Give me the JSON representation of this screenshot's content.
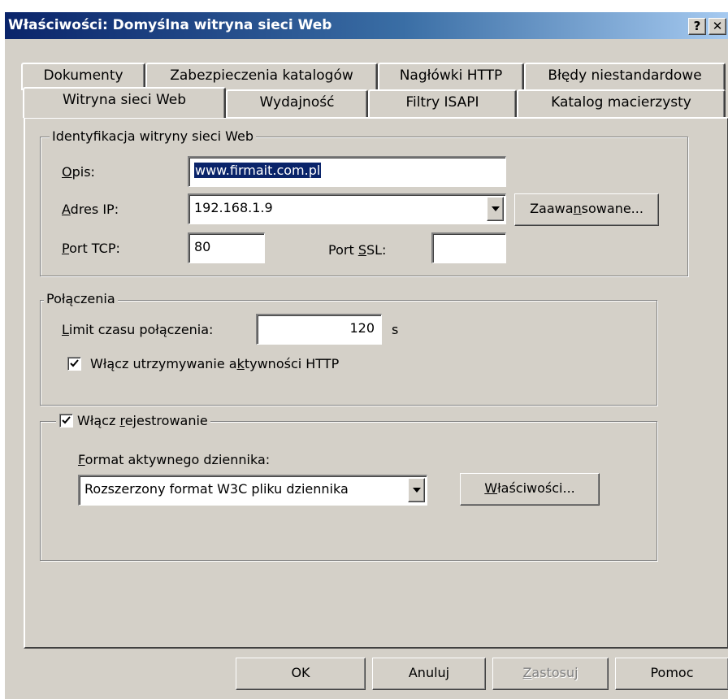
{
  "window": {
    "title": "Właściwości: Domyślna witryna sieci Web",
    "help_glyph": "?",
    "close_glyph": "✕"
  },
  "tabs_row1": [
    "Dokumenty",
    "Zabezpieczenia katalogów",
    "Nagłówki HTTP",
    "Błędy niestandardowe"
  ],
  "tabs_row2": [
    "Witryna sieci Web",
    "Wydajność",
    "Filtry ISAPI",
    "Katalog macierzysty"
  ],
  "active_tab": "Witryna sieci Web",
  "identification": {
    "legend": "Identyfikacja witryny sieci Web",
    "description_label_u": "O",
    "description_label_rest": "pis:",
    "description_value": "www.firmait.com.pl",
    "ip_label_u": "A",
    "ip_label_rest": "dres IP:",
    "ip_value": "192.168.1.9",
    "advanced_pre": "Zaawa",
    "advanced_u": "n",
    "advanced_post": "sowane...",
    "tcp_label_u": "P",
    "tcp_label_rest": "ort TCP:",
    "tcp_value": "80",
    "ssl_label_pre": "Port ",
    "ssl_label_u": "S",
    "ssl_label_post": "SL:",
    "ssl_value": ""
  },
  "connections": {
    "legend": "Połączenia",
    "timeout_label_u": "L",
    "timeout_label_rest": "imit czasu połączenia:",
    "timeout_value": "120",
    "timeout_unit": "s",
    "keepalive_pre": "Włącz utrzymywanie a",
    "keepalive_u": "k",
    "keepalive_post": "tywności HTTP",
    "keepalive_checked": true
  },
  "logging": {
    "enable_pre": "Włącz ",
    "enable_u": "r",
    "enable_post": "ejestrowanie",
    "enabled": true,
    "format_label_u": "F",
    "format_label_rest": "ormat aktywnego dziennika:",
    "format_value": "Rozszerzony format W3C pliku dziennika",
    "properties_u": "W",
    "properties_rest": "łaściwości..."
  },
  "buttons": {
    "ok": "OK",
    "cancel": "Anuluj",
    "apply_u": "Z",
    "apply_rest": "astosuj",
    "help": "Pomoc"
  }
}
